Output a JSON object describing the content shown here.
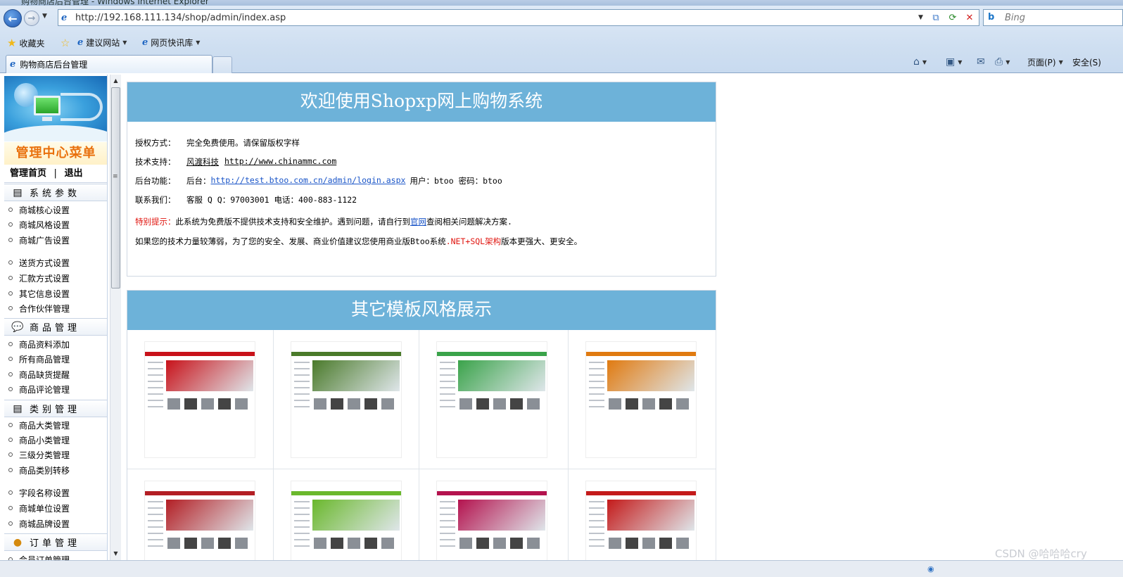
{
  "window": {
    "title": "购物商店后台管理 - Windows Internet Explorer"
  },
  "address": {
    "url": "http://192.168.111.134/shop/admin/index.asp"
  },
  "search": {
    "placeholder": "Bing"
  },
  "favorites": {
    "label": "收藏夹",
    "items": [
      "建议网站",
      "网页快讯库"
    ]
  },
  "tab": {
    "title": "购物商店后台管理"
  },
  "commands": {
    "page": "页面(P)",
    "safety": "安全(S)"
  },
  "sidebar": {
    "title": "管理中心菜单",
    "home": "管理首页",
    "separator": "|",
    "logout": "退出",
    "sections": [
      {
        "label": "系统参数",
        "icon": "settings-icon",
        "items": [
          "商城核心设置",
          "商城风格设置",
          "商城广告设置",
          "送货方式设置",
          "汇款方式设置",
          "其它信息设置",
          "合作伙伴管理"
        ]
      },
      {
        "label": "商品管理",
        "icon": "chat-bubble-icon",
        "items": [
          "商品资料添加",
          "所有商品管理",
          "商品缺货提醒",
          "商品评论管理"
        ]
      },
      {
        "label": "类别管理",
        "icon": "category-icon",
        "items": [
          "商品大类管理",
          "商品小类管理",
          "三级分类管理",
          "商品类别转移",
          "字段名称设置",
          "商城单位设置",
          "商城品牌设置"
        ]
      },
      {
        "label": "订单管理",
        "icon": "coins-icon",
        "items": [
          "会员订单管理"
        ]
      }
    ]
  },
  "welcome": {
    "title": "欢迎使用Shopxp网上购物系统",
    "rows": [
      {
        "label": "授权方式：",
        "text": "完全免费使用。请保留版权字样"
      },
      {
        "label": "技术支持：",
        "company": "风渡科技",
        "site": "http://www.chinammc.com"
      },
      {
        "label": "后台功能：",
        "prefix": "后台：",
        "link": "http://test.btoo.com.cn/admin/login.aspx",
        "suffix": "用户：btoo 密码：btoo"
      },
      {
        "label": "联系我们：",
        "text": "客服 Q Q：97003001 电话：400-883-1122"
      }
    ],
    "notice_label": "特别提示：",
    "notice_text": "此系统为免费版不提供技术支持和安全维护。遇到问题，请自行到",
    "notice_link": "官网",
    "notice_tail": " 查阅相关问题解决方案.",
    "upgrade_text": "如果您的技术力量较薄弱，为了您的安全、发展、商业价值建议您使用商业版Btoo系统",
    "upgrade_highlight": " .NET+SQL架构",
    "upgrade_tail": " 版本更强大、更安全。"
  },
  "templates": {
    "title": "其它模板风格展示",
    "accent_colors": [
      "#c8121a",
      "#4a7a2a",
      "#3aa34a",
      "#e07a10",
      "#b31e24",
      "#6ab82c",
      "#b4124e",
      "#c41a1a"
    ]
  },
  "watermark": "CSDN @哈哈哈cry"
}
